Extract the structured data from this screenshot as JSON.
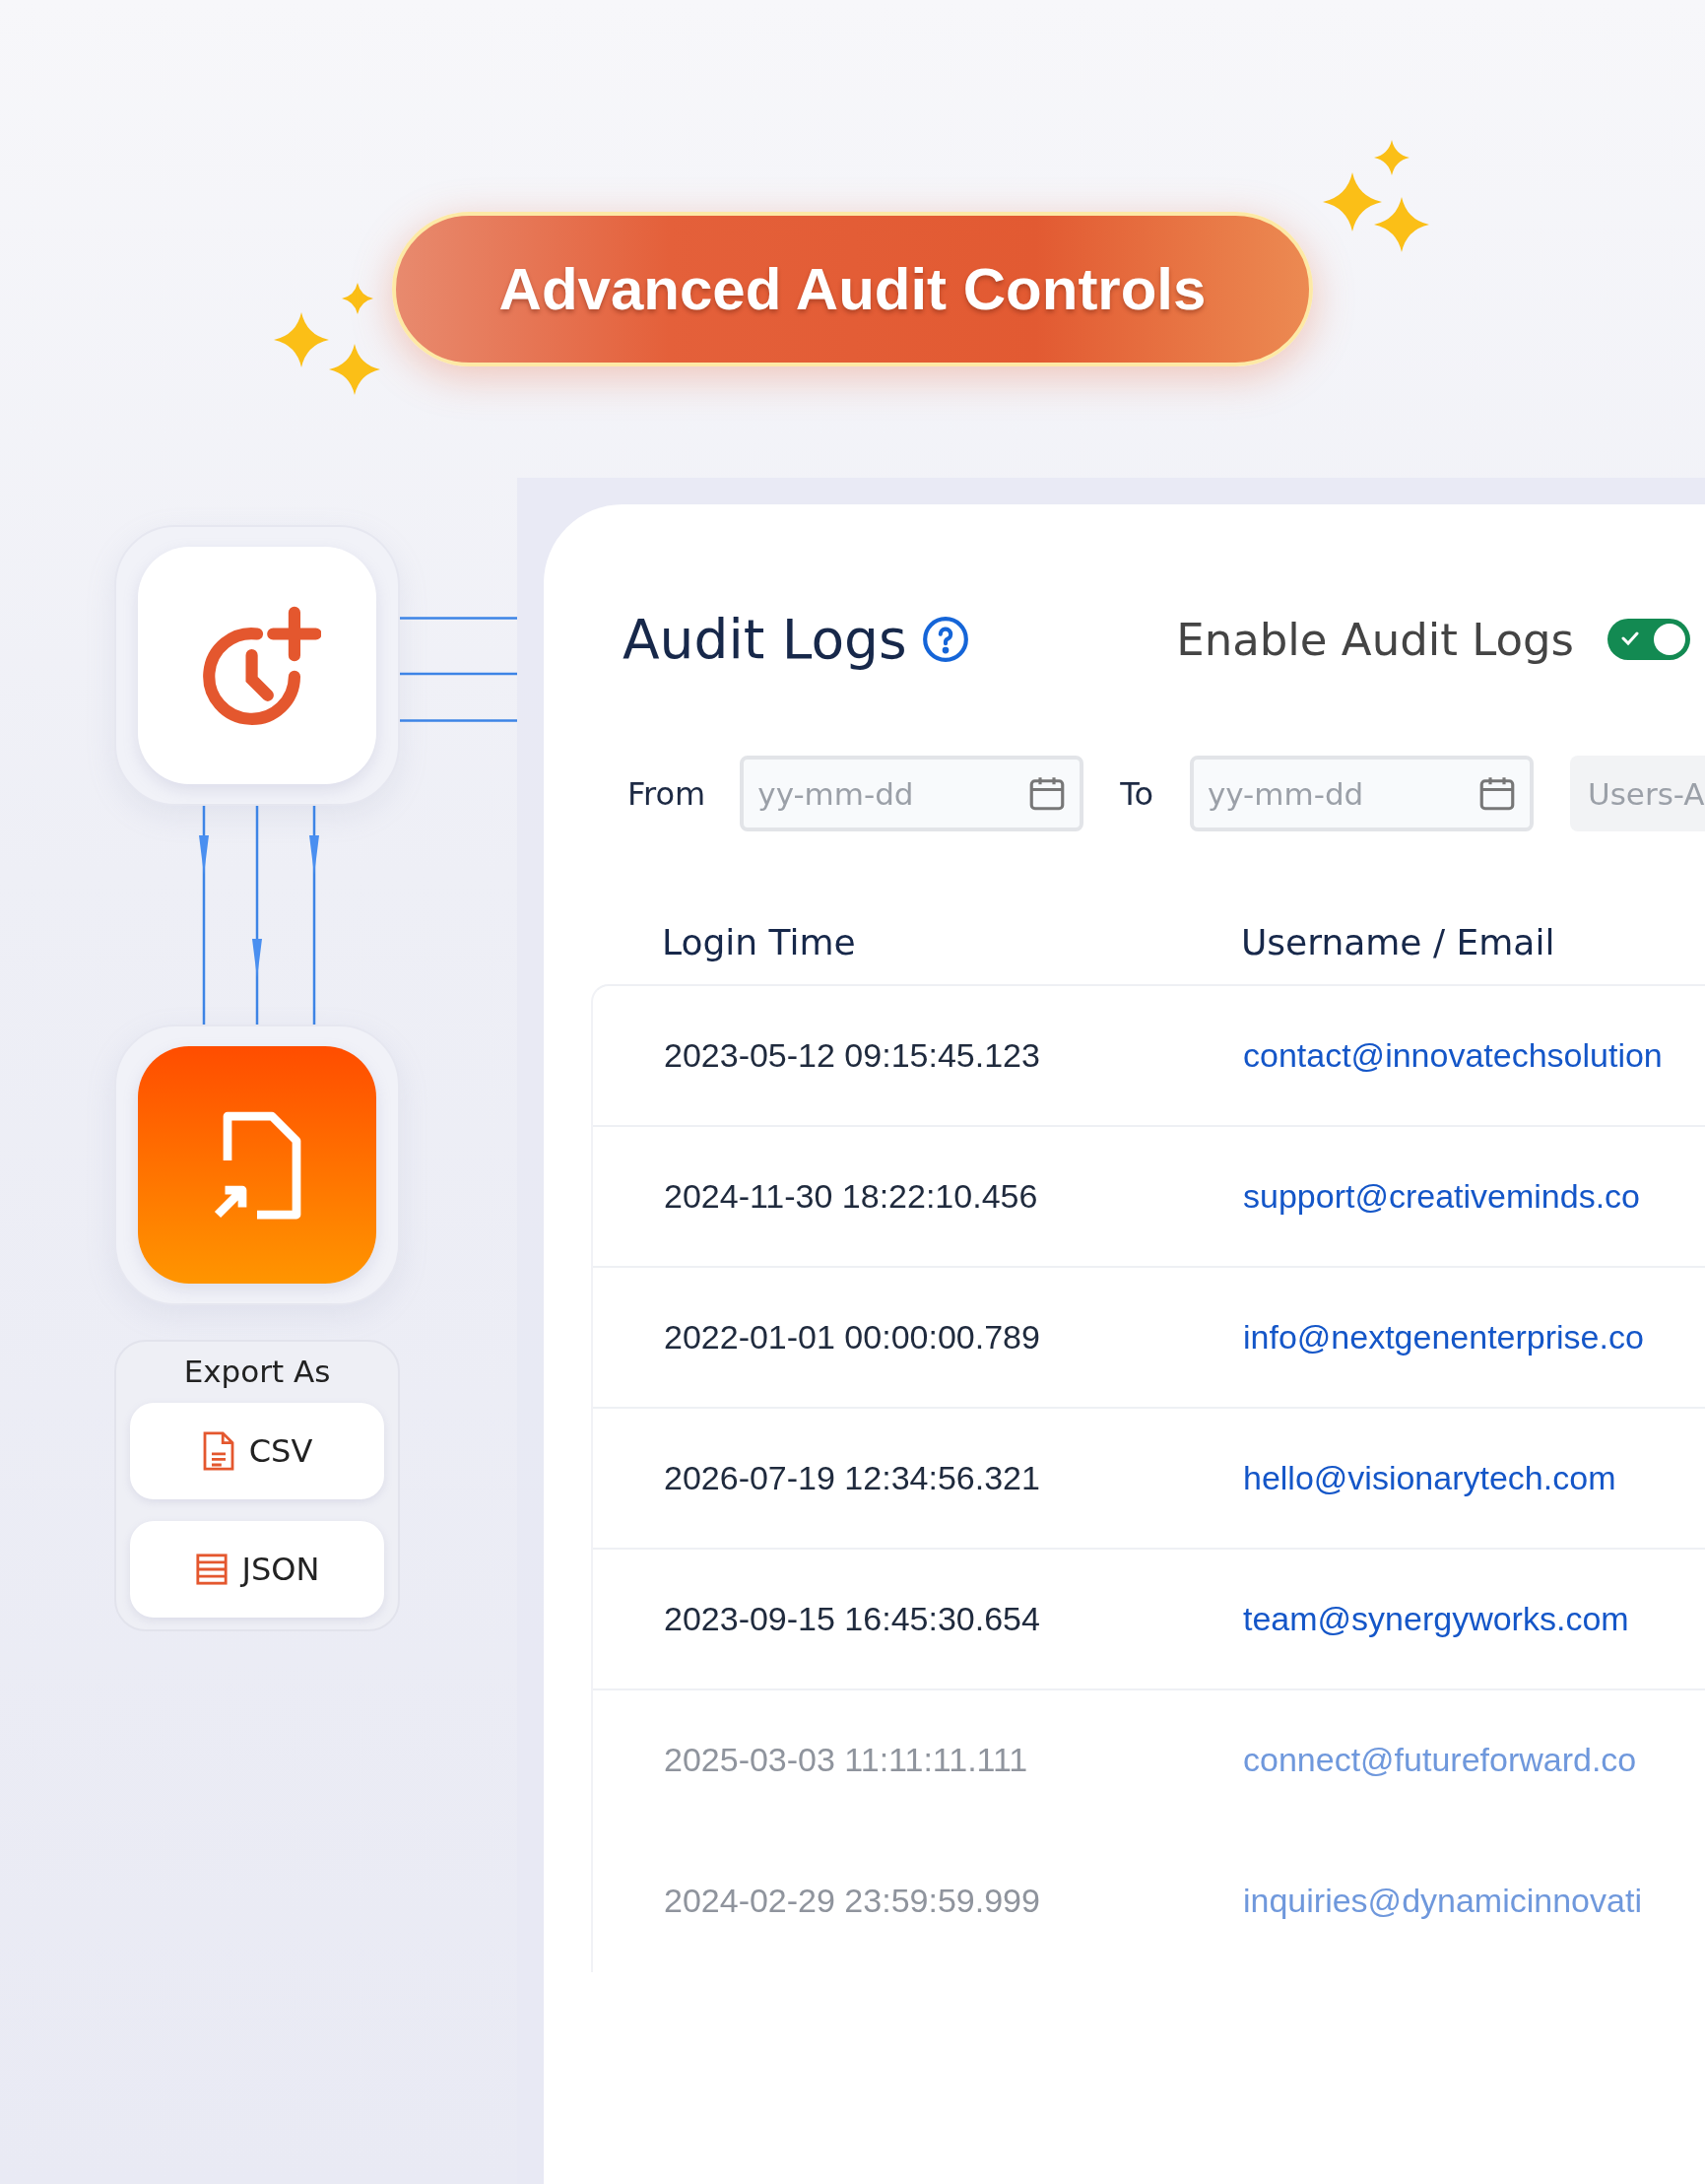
{
  "banner": {
    "title": "Advanced Audit Controls"
  },
  "export": {
    "label": "Export As",
    "formats": [
      {
        "label": "CSV",
        "kind": "csv"
      },
      {
        "label": "JSON",
        "kind": "json"
      }
    ]
  },
  "audit": {
    "title": "Audit Logs",
    "toggle_label": "Enable Audit Logs",
    "enabled": true,
    "filters": {
      "from_label": "From",
      "from_placeholder": "yy-mm-dd",
      "to_label": "To",
      "to_placeholder": "yy-mm-dd",
      "users_placeholder": "Users-A"
    },
    "columns": [
      "Login Time",
      "Username / Email"
    ],
    "rows": [
      {
        "time": "2023-05-12 09:15:45.123",
        "email": "contact@innovatechsolution",
        "faded": false
      },
      {
        "time": "2024-11-30 18:22:10.456",
        "email": "support@creativeminds.co",
        "faded": false
      },
      {
        "time": "2022-01-01 00:00:00.789",
        "email": "info@nextgenenterprise.co",
        "faded": false
      },
      {
        "time": "2026-07-19 12:34:56.321",
        "email": "hello@visionarytech.com",
        "faded": false
      },
      {
        "time": "2023-09-15 16:45:30.654",
        "email": "team@synergyworks.com",
        "faded": false
      },
      {
        "time": "2025-03-03 11:11:11.111",
        "email": "connect@futureforward.co",
        "faded": true
      },
      {
        "time": "2024-02-29 23:59:59.999",
        "email": "inquiries@dynamicinnovati",
        "faded": true
      }
    ]
  }
}
